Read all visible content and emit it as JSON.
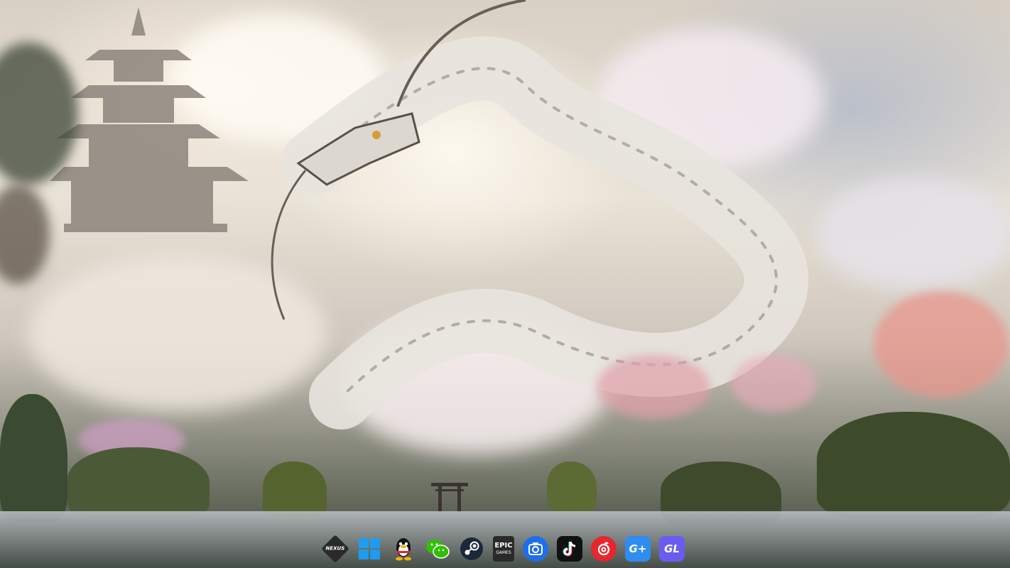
{
  "desktop": {
    "wallpaper": "white-dragon-pagoda-landscape"
  },
  "taskbar": {
    "apps": [
      {
        "id": "nexus",
        "label": "NEXUS",
        "icon": "nexus-icon",
        "color": "#2a2a2a"
      },
      {
        "id": "windows",
        "label": "",
        "icon": "windows-icon",
        "color": "#1f9cf0"
      },
      {
        "id": "qq",
        "label": "",
        "icon": "qq-penguin-icon",
        "color": "#ffffff"
      },
      {
        "id": "wechat",
        "label": "",
        "icon": "wechat-icon",
        "color": "#2dc100"
      },
      {
        "id": "steam",
        "label": "",
        "icon": "steam-icon",
        "color": "#1b2838"
      },
      {
        "id": "epic",
        "label": "EPIC GAMES",
        "label_line1": "EPIC",
        "label_line2": "GAMES",
        "icon": "epic-games-icon",
        "color": "#2a2a2a"
      },
      {
        "id": "screen-capture",
        "label": "",
        "icon": "camera-icon",
        "color": "#1e6fe8"
      },
      {
        "id": "tiktok",
        "label": "",
        "icon": "tiktok-icon",
        "color": "#111111"
      },
      {
        "id": "netease-music",
        "label": "",
        "icon": "netease-music-icon",
        "color": "#e8262b"
      },
      {
        "id": "gplus",
        "label": "G+",
        "icon": "g-plus-icon",
        "color": "#2f8cf0"
      },
      {
        "id": "gl",
        "label": "GL",
        "icon": "gl-icon",
        "color": "#6a5cf0"
      }
    ]
  }
}
